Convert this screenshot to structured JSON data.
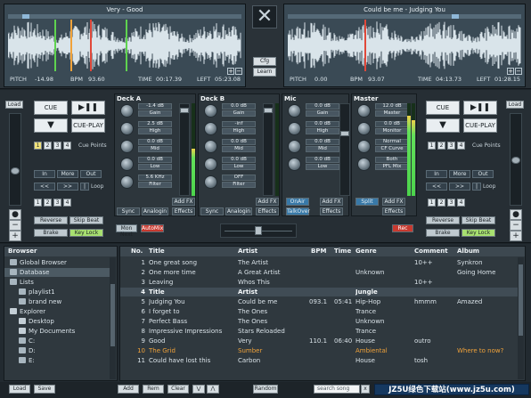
{
  "deck_left": {
    "title": "Very - Good",
    "pitch_label": "PITCH",
    "pitch": "-14.98",
    "bpm_label": "BPM",
    "bpm": "93.60",
    "time_label": "TIME",
    "time": "00:17.39",
    "left_label": "LEFT",
    "left": "05:23.08"
  },
  "deck_right": {
    "title": "Could be me - Judging You",
    "pitch_label": "PITCH",
    "pitch": "0.00",
    "bpm_label": "BPM",
    "bpm": "93.07",
    "time_label": "TIME",
    "time": "04:13.73",
    "left_label": "LEFT",
    "left": "01:28.15"
  },
  "center": {
    "logo": "✕",
    "cfg": "Cfg",
    "learn": "Learn"
  },
  "panel_left": {
    "load": "Load",
    "cue": "CUE",
    "play_icon": "▶❚❚",
    "sync_icon": "▼",
    "cue_play": "CUE-PLAY",
    "cue_points": [
      "1",
      "2",
      "3",
      "4"
    ],
    "cue_points_label": "Cue Points",
    "in": "In",
    "more": "More",
    "out": "Out",
    "loop_back": "<<",
    "loop_fwd": ">>",
    "loop_toggle": "|",
    "loop_label": "Loop",
    "loop_sizes": [
      "1",
      "2",
      "3",
      "4"
    ],
    "reverse": "Reverse",
    "skip_beat": "Skip Beat",
    "brake": "Brake",
    "key_lock": "Key Lock",
    "plus": "+",
    "minus": "−",
    "dot": "●"
  },
  "panel_right": {
    "load": "Load",
    "cue": "CUE",
    "play_icon": "▶❚❚",
    "sync_icon": "▼",
    "cue_play": "CUE-PLAY",
    "cue_points": [
      "1",
      "2",
      "3",
      "4"
    ],
    "cue_points_label": "Cue Points",
    "in": "In",
    "more": "More",
    "out": "Out",
    "loop_back": "<<",
    "loop_fwd": ">>",
    "loop_toggle": "|",
    "loop_label": "Loop",
    "loop_sizes": [
      "1",
      "2",
      "3",
      "4"
    ],
    "reverse": "Reverse",
    "skip_beat": "Skip Beat",
    "brake": "Brake",
    "key_lock": "Key Lock",
    "plus": "+",
    "minus": "−",
    "dot": "●"
  },
  "deck_a": {
    "title": "Deck A",
    "knobs": [
      {
        "value": "-1.4 dB",
        "label": "Gain"
      },
      {
        "value": "2.5 dB",
        "label": "High"
      },
      {
        "value": "0.0 dB",
        "label": "Mid"
      },
      {
        "value": "0.0 dB",
        "label": "Low"
      },
      {
        "value": "5.6 KHz",
        "label": "Filter"
      }
    ],
    "add_fx": "Add FX",
    "sync": "Sync",
    "analog": "Analogin",
    "effects": "Effects",
    "vu_level": 0.52
  },
  "deck_b": {
    "title": "Deck B",
    "knobs": [
      {
        "value": "0.0 dB",
        "label": "Gain"
      },
      {
        "value": "-inf",
        "label": "High"
      },
      {
        "value": "0.0 dB",
        "label": "Mid"
      },
      {
        "value": "0.0 dB",
        "label": "Low"
      },
      {
        "value": "OFF",
        "label": "Filter"
      }
    ],
    "add_fx": "Add FX",
    "sync": "Sync",
    "analog": "Analogin",
    "effects": "Effects",
    "vu_level": 0.0
  },
  "mic": {
    "title": "Mic",
    "knobs": [
      {
        "value": "0.0 dB",
        "label": "Gain"
      },
      {
        "value": "0.0 dB",
        "label": "High"
      },
      {
        "value": "0.0 dB",
        "label": "Mid"
      },
      {
        "value": "0.0 dB",
        "label": "Low"
      }
    ],
    "onair": "OnAir",
    "add_fx": "Add FX",
    "talkover": "TalkOver",
    "effects": "Effects"
  },
  "master": {
    "title": "Master",
    "knobs": [
      {
        "value": "12.0 dB",
        "label": "Master"
      },
      {
        "value": "0.0 dB",
        "label": "Monitor"
      },
      {
        "value": "Normal",
        "label": "CF Curve"
      },
      {
        "value": "Both",
        "label": "PFL Mix"
      }
    ],
    "split": "Split",
    "add_fx": "Add FX",
    "effects": "Effects",
    "vu_level": 0.88
  },
  "mixer_bottom": {
    "mon_next": "Mon Next",
    "automix": "AutoMix",
    "rec": "Rec"
  },
  "browser": {
    "header": "Browser",
    "items": [
      {
        "label": "Global Browser",
        "icon": "globe-icon",
        "indent": 1
      },
      {
        "label": "Database",
        "icon": "database-icon",
        "indent": 1,
        "selected": true
      },
      {
        "label": "Lists",
        "icon": "list-icon",
        "indent": 1
      },
      {
        "label": "playlist1",
        "icon": "playlist-icon",
        "indent": 2
      },
      {
        "label": "brand new",
        "icon": "playlist-icon",
        "indent": 2
      },
      {
        "label": "Explorer",
        "icon": "folder-icon",
        "indent": 1
      },
      {
        "label": "Desktop",
        "icon": "folder-icon",
        "indent": 2
      },
      {
        "label": "My Documents",
        "icon": "folder-icon",
        "indent": 2
      },
      {
        "label": "C:",
        "icon": "drive-icon",
        "indent": 2
      },
      {
        "label": "D:",
        "icon": "drive-icon",
        "indent": 2
      },
      {
        "label": "E:",
        "icon": "drive-icon",
        "indent": 2
      }
    ]
  },
  "tracks": {
    "columns": [
      "No.",
      "Title",
      "Artist",
      "BPM",
      "Time",
      "Genre",
      "Comment",
      "Album"
    ],
    "rows": [
      {
        "no": "1",
        "title": "One great song",
        "artist": "The Artist",
        "bpm": "",
        "time": "",
        "genre": "",
        "comment": "10++",
        "album": "Synkron"
      },
      {
        "no": "2",
        "title": "One more time",
        "artist": "A Great Artist",
        "bpm": "",
        "time": "",
        "genre": "Unknown",
        "comment": "",
        "album": "Going Home"
      },
      {
        "no": "3",
        "title": "Leaving",
        "artist": "Whos This",
        "bpm": "",
        "time": "",
        "genre": "",
        "comment": "10++",
        "album": ""
      },
      {
        "no": "4",
        "title": "Title",
        "artist": "Artist",
        "bpm": "",
        "time": "",
        "genre": "Jungle",
        "comment": "",
        "album": "",
        "group": true
      },
      {
        "no": "5",
        "title": "Judging You",
        "artist": "Could be me",
        "bpm": "093.1",
        "time": "05:41",
        "genre": "Hip-Hop",
        "comment": "hmmm",
        "album": "Amazed"
      },
      {
        "no": "6",
        "title": "I forget to",
        "artist": "The Ones",
        "bpm": "",
        "time": "",
        "genre": "Trance",
        "comment": "",
        "album": ""
      },
      {
        "no": "7",
        "title": "Perfect Bass",
        "artist": "The Ones",
        "bpm": "",
        "time": "",
        "genre": "Unknown",
        "comment": "",
        "album": ""
      },
      {
        "no": "8",
        "title": "Impressive Impressions",
        "artist": "Stars Reloaded",
        "bpm": "",
        "time": "",
        "genre": "Trance",
        "comment": "",
        "album": ""
      },
      {
        "no": "9",
        "title": "Good",
        "artist": "Very",
        "bpm": "110.1",
        "time": "06:40",
        "genre": "House",
        "comment": "outro",
        "album": ""
      },
      {
        "no": "10",
        "title": "The Grid",
        "artist": "Sumber",
        "bpm": "",
        "time": "",
        "genre": "Ambiental",
        "comment": "",
        "album": "Where to now?",
        "highlight": true
      },
      {
        "no": "11",
        "title": "Could have lost this",
        "artist": "Carbon",
        "bpm": "",
        "time": "",
        "genre": "House",
        "comment": "tosh",
        "album": ""
      }
    ]
  },
  "bottom_bar": {
    "load": "Load",
    "save": "Save",
    "add": "Add",
    "rem": "Rem",
    "clear": "Clear",
    "down": "⋁",
    "up": "⋀",
    "random": "Random",
    "search_placeholder": "search song",
    "search_clear": "x",
    "watermark": "JZ5U绿色下载站(www.jz5u.com)"
  },
  "colors": {
    "accent_blue": "#3879a8",
    "rec_red": "#c83a30",
    "key_lock_green": "#a8e070",
    "highlight_orange": "#f0a23a",
    "vu_green": "#4cd44c"
  }
}
